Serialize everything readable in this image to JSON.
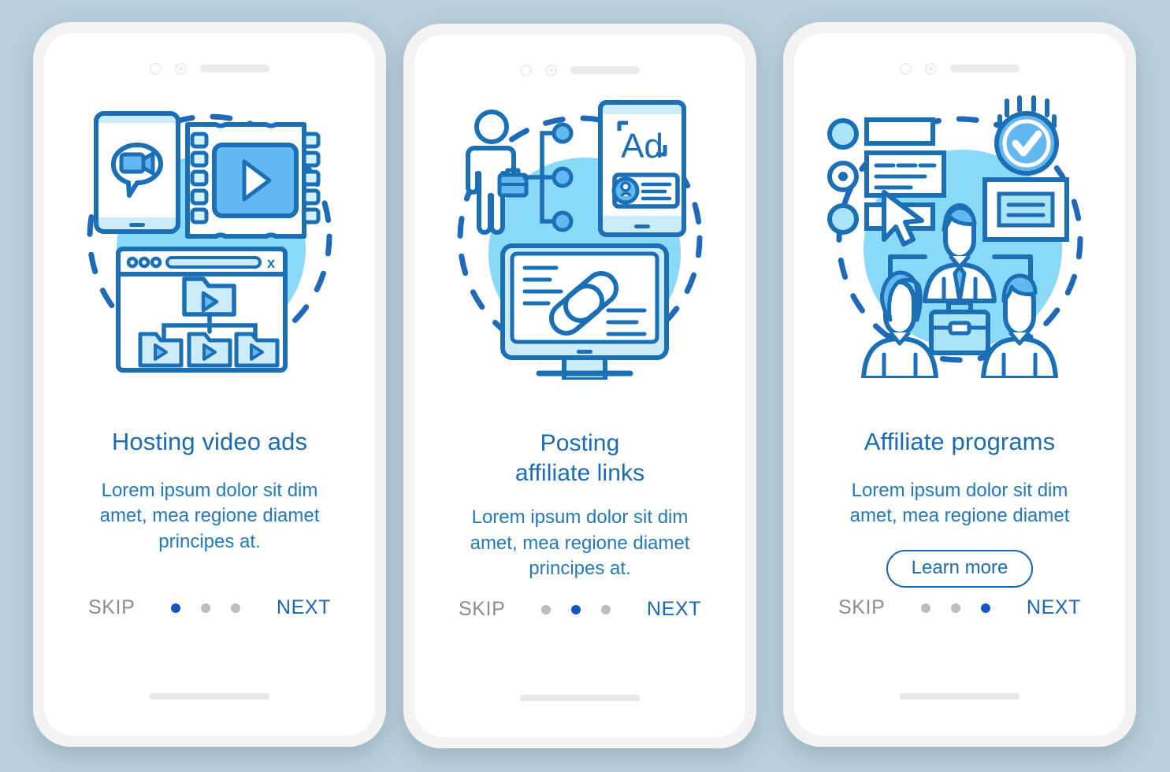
{
  "theme": {
    "background": "#b9ced9",
    "phone_frame": "#f3f3f2",
    "screen": "#ffffff",
    "title_blue": "#1b6cb0",
    "subtitle_blue": "#2279bd",
    "accent_stroke": "#1a6fb5",
    "fill_light_cyan": "#8ad9f7",
    "fill_pale": "#ccecfa",
    "fill_mid_blue": "#63b9ef",
    "dot_active": "#1456c4",
    "dot_inactive": "#bcbcbc",
    "skip_gray": "#8d8d8d",
    "next_blue": "#1c68b8"
  },
  "screens": [
    {
      "id": "hosting-video-ads",
      "illustration": "video-ads-illustration",
      "title": "Hosting  video ads",
      "subtitle": "Lorem ipsum dolor sit dim amet, mea regione diamet principes at.",
      "skip_label": "SKIP",
      "next_label": "NEXT",
      "cta_label": null,
      "has_cta": false,
      "dots": 3,
      "active_dot": 0
    },
    {
      "id": "posting-affiliate-links",
      "illustration": "affiliate-links-illustration",
      "title": "Posting\naffiliate links",
      "title_line1": "Posting",
      "title_line2": "affiliate links",
      "subtitle": "Lorem ipsum dolor sit dim amet, mea regione diamet principes at.",
      "skip_label": "SKIP",
      "next_label": "NEXT",
      "cta_label": null,
      "has_cta": false,
      "dots": 3,
      "active_dot": 1
    },
    {
      "id": "affiliate-programs",
      "illustration": "affiliate-programs-illustration",
      "title": "Affiliate programs",
      "subtitle": "Lorem ipsum dolor sit dim amet, mea regione diamet",
      "skip_label": "SKIP",
      "next_label": "NEXT",
      "cta_label": "Learn more",
      "has_cta": true,
      "dots": 3,
      "active_dot": 2
    }
  ],
  "illustration_labels": {
    "ad_text": "Ad",
    "browser_close": "x"
  }
}
